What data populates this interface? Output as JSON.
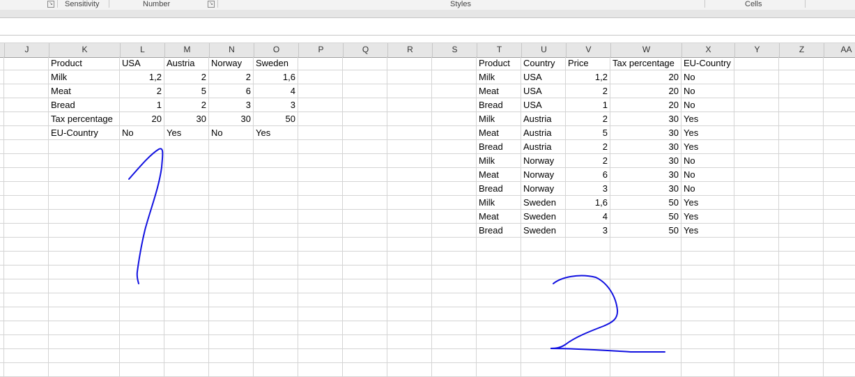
{
  "ribbon": {
    "groups": [
      {
        "label": "Sensitivity"
      },
      {
        "label": "Number"
      },
      {
        "label": "Styles"
      },
      {
        "label": "Cells"
      }
    ]
  },
  "columns": [
    "J",
    "K",
    "L",
    "M",
    "N",
    "O",
    "P",
    "Q",
    "R",
    "S",
    "T",
    "U",
    "V",
    "W",
    "X",
    "Y",
    "Z",
    "AA"
  ],
  "table1": {
    "headers": [
      "Product",
      "USA",
      "Austria",
      "Norway",
      "Sweden"
    ],
    "rows": [
      [
        "Milk",
        "1,2",
        "2",
        "2",
        "1,6"
      ],
      [
        "Meat",
        "2",
        "5",
        "6",
        "4"
      ],
      [
        "Bread",
        "1",
        "2",
        "3",
        "3"
      ],
      [
        "Tax percentage",
        "20",
        "30",
        "30",
        "50"
      ],
      [
        "EU-Country",
        "No",
        "Yes",
        "No",
        "Yes"
      ]
    ]
  },
  "table2": {
    "headers": [
      "Product",
      "Country",
      "Price",
      "Tax percentage",
      "EU-Country"
    ],
    "rows": [
      [
        "Milk",
        "USA",
        "1,2",
        "20",
        "No"
      ],
      [
        "Meat",
        "USA",
        "2",
        "20",
        "No"
      ],
      [
        "Bread",
        "USA",
        "1",
        "20",
        "No"
      ],
      [
        "Milk",
        "Austria",
        "2",
        "30",
        "Yes"
      ],
      [
        "Meat",
        "Austria",
        "5",
        "30",
        "Yes"
      ],
      [
        "Bread",
        "Austria",
        "2",
        "30",
        "Yes"
      ],
      [
        "Milk",
        "Norway",
        "2",
        "30",
        "No"
      ],
      [
        "Meat",
        "Norway",
        "6",
        "30",
        "No"
      ],
      [
        "Bread",
        "Norway",
        "3",
        "30",
        "No"
      ],
      [
        "Milk",
        "Sweden",
        "1,6",
        "50",
        "Yes"
      ],
      [
        "Meat",
        "Sweden",
        "4",
        "50",
        "Yes"
      ],
      [
        "Bread",
        "Sweden",
        "3",
        "50",
        "Yes"
      ]
    ]
  },
  "annotations": {
    "ink_color": "#1010e0",
    "label_1": "1",
    "label_2": "2"
  }
}
